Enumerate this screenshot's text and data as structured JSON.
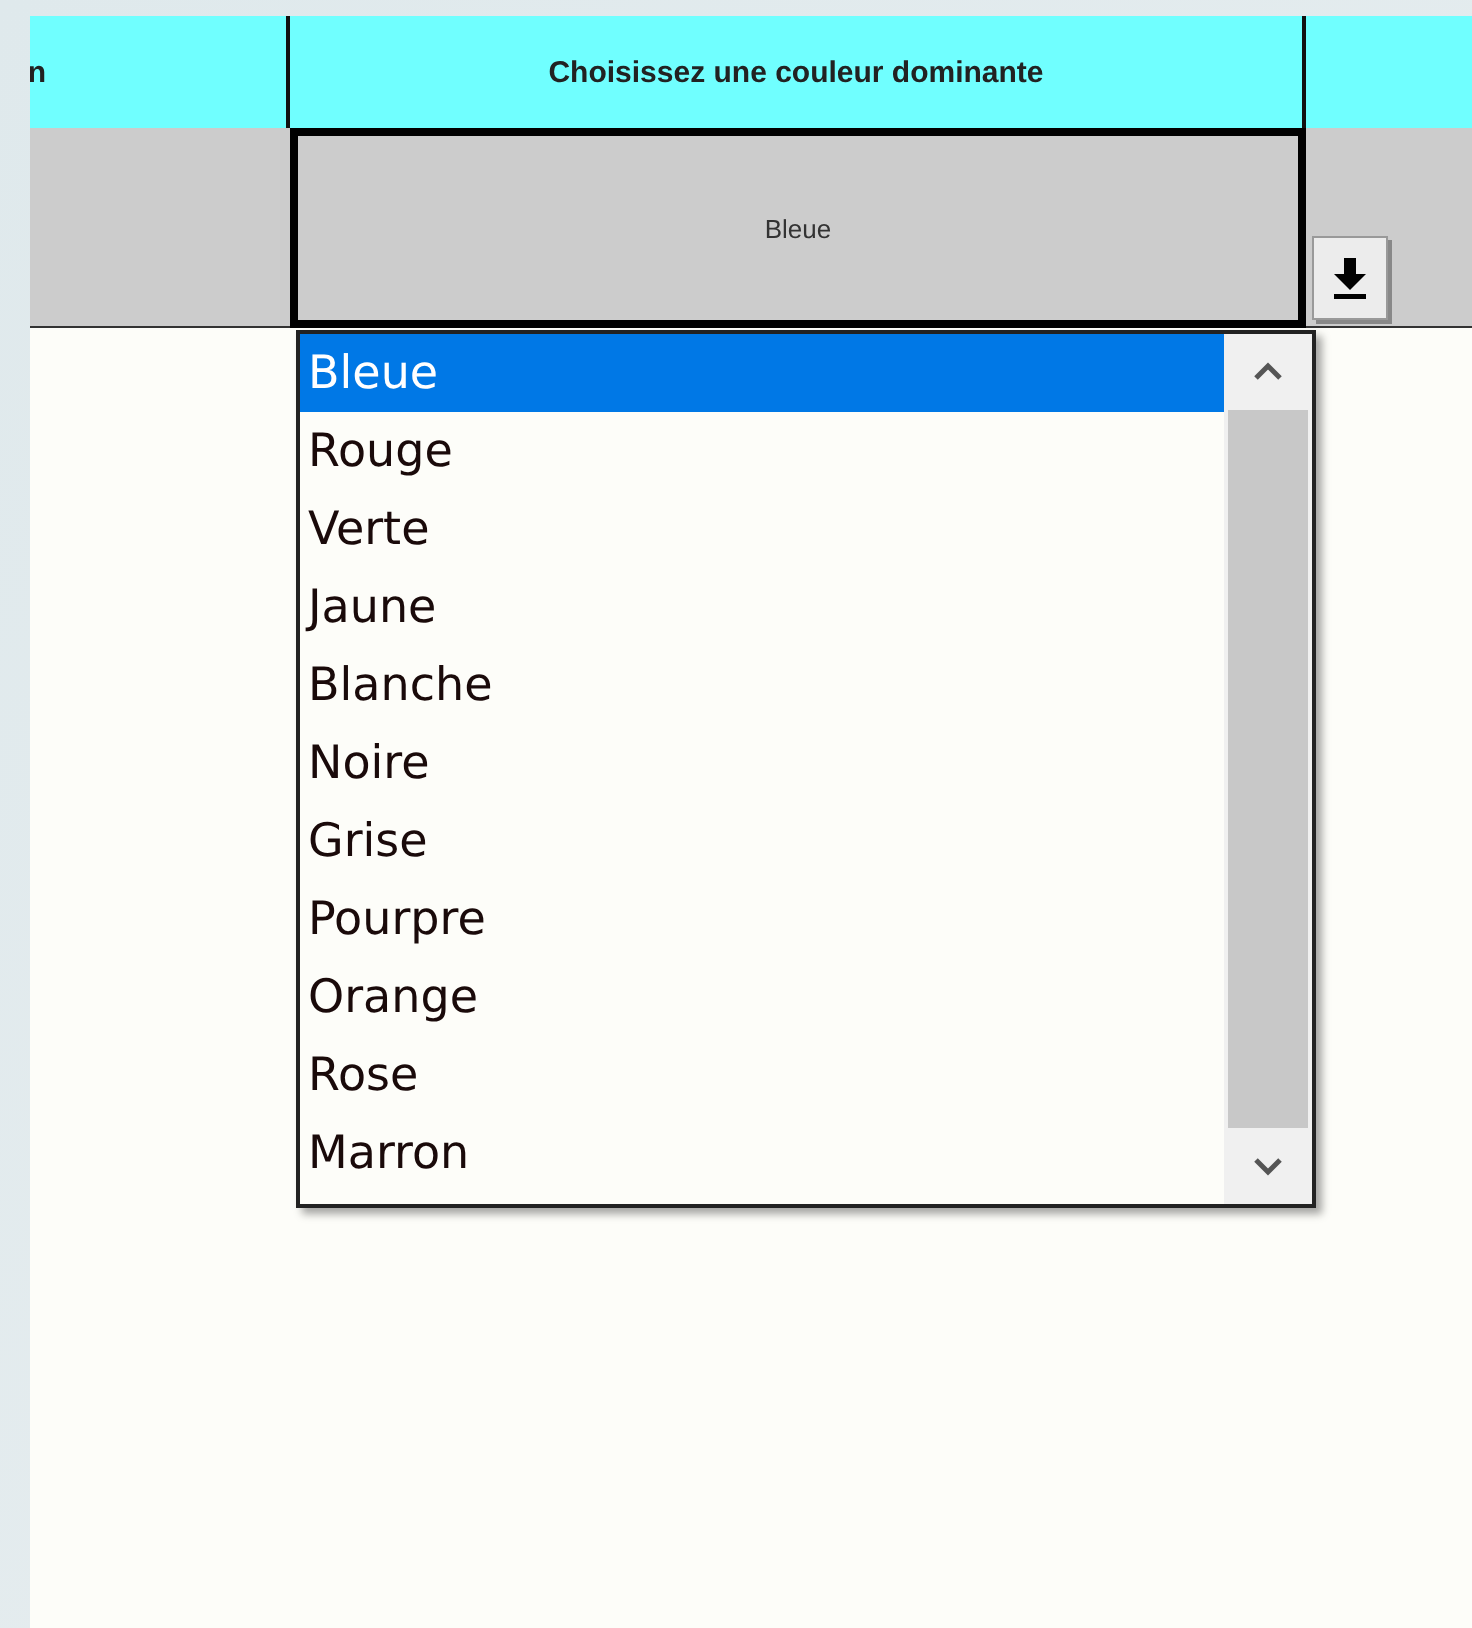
{
  "sheet": {
    "header": {
      "column_1": "n",
      "column_2": "Choisissez une couleur dominante"
    },
    "row": {
      "column_2": "Bleue"
    }
  },
  "dropdown": {
    "options": [
      {
        "label": "Bleue",
        "selected": true
      },
      {
        "label": "Rouge",
        "selected": false
      },
      {
        "label": "Verte",
        "selected": false
      },
      {
        "label": "Jaune",
        "selected": false
      },
      {
        "label": "Blanche",
        "selected": false
      },
      {
        "label": "Noire",
        "selected": false
      },
      {
        "label": "Grise",
        "selected": false
      },
      {
        "label": "Pourpre",
        "selected": false
      },
      {
        "label": "Orange",
        "selected": false
      },
      {
        "label": "Rose",
        "selected": false
      },
      {
        "label": "Marron",
        "selected": false
      }
    ]
  }
}
